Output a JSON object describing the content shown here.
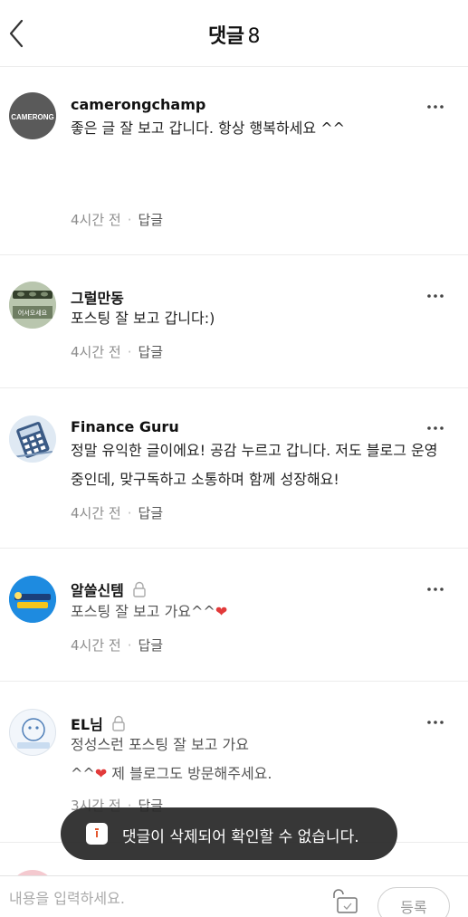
{
  "header": {
    "title": "댓글",
    "count": "8"
  },
  "comments": [
    {
      "author": "camerongchamp",
      "avatar_text": "CAMERONG",
      "text_lines": [
        "좋은 글 잘 보고 갑니다. 항상 행복하세요 ^^"
      ],
      "time": "4시간 전",
      "reply": "답글",
      "locked": false
    },
    {
      "author": "그럴만동",
      "avatar_text": "어서오세요",
      "text_lines": [
        "포스팅 잘 보고 갑니다:)"
      ],
      "time": "4시간 전",
      "reply": "답글",
      "locked": false
    },
    {
      "author": "Finance Guru",
      "text_lines": [
        "정말 유익한 글이에요! 공감 누르고 갑니다. 저도 블로그 운영",
        "중인데, 맞구독하고 소통하며 함께 성장해요!"
      ],
      "time": "4시간 전",
      "reply": "답글",
      "locked": false
    },
    {
      "author": "알쓸신템",
      "text_before_heart": "포스팅 잘 보고 가요^^",
      "heart": "❤",
      "time": "4시간 전",
      "reply": "답글",
      "locked": true
    },
    {
      "author": "EL님",
      "text_line1": "정성스런 포스팅 잘 보고 가요",
      "text_line2_prefix": "^^",
      "heart": "❤",
      "text_line2_suffix": " 제 블로그도 방문해주세요.",
      "time": "3시간 전",
      "reply": "답글",
      "locked": true
    }
  ],
  "toast": {
    "message": "댓글이 삭제되어 확인할 수 없습니다."
  },
  "input": {
    "placeholder": "내용을 입력하세요.",
    "submit_label": "등록"
  },
  "colors": {
    "heart": "#e23a3a",
    "toast_bg": "#282828"
  }
}
